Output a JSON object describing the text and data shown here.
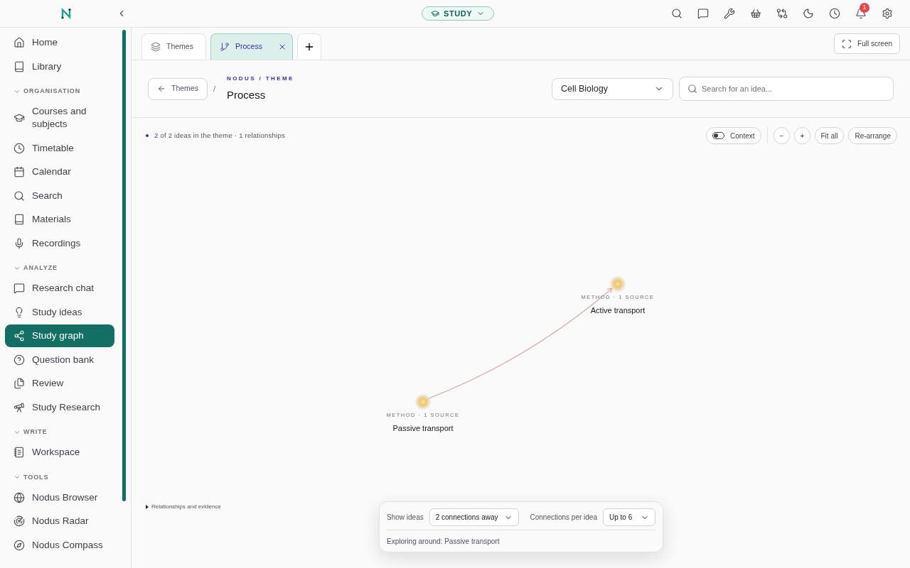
{
  "header": {
    "mode_button": "STUDY",
    "notification_count": "1"
  },
  "sidebar": {
    "top_items": [
      {
        "label": "Home",
        "selected": false
      },
      {
        "label": "Library",
        "selected": false
      }
    ],
    "sections": [
      {
        "title": "ORGANISATION",
        "expanded": true,
        "items": [
          {
            "label": "Courses and subjects",
            "selected": false
          },
          {
            "label": "Timetable",
            "selected": false
          },
          {
            "label": "Calendar",
            "selected": false
          },
          {
            "label": "Search",
            "selected": false
          },
          {
            "label": "Materials",
            "selected": false
          },
          {
            "label": "Recordings",
            "selected": false
          }
        ]
      },
      {
        "title": "ANALYZE",
        "expanded": true,
        "items": [
          {
            "label": "Research chat",
            "selected": false
          },
          {
            "label": "Study ideas",
            "selected": false
          },
          {
            "label": "Study graph",
            "selected": true
          },
          {
            "label": "Question bank",
            "selected": false
          },
          {
            "label": "Review",
            "selected": false
          },
          {
            "label": "Study Research",
            "selected": false
          }
        ]
      },
      {
        "title": "WRITE",
        "expanded": true,
        "items": [
          {
            "label": "Workspace",
            "selected": false
          }
        ]
      },
      {
        "title": "TOOLS",
        "expanded": true,
        "items": [
          {
            "label": "Nodus Browser",
            "selected": false
          },
          {
            "label": "Nodus Radar",
            "selected": false
          },
          {
            "label": "Nodus Compass",
            "selected": false
          }
        ]
      }
    ]
  },
  "tabs": [
    {
      "label": "Themes",
      "selected": false,
      "closable": false
    },
    {
      "label": "Process",
      "selected": true,
      "closable": true
    }
  ],
  "full_screen_button": "Full screen",
  "page": {
    "back_button": "Themes",
    "separator": "/",
    "eyebrow": "NODUS / THEME",
    "title": "Process",
    "subject_select": "Cell Biology",
    "search": {
      "placeholder": "Search for an idea..."
    }
  },
  "graph": {
    "summary": "2 of 2 ideas in the theme · 1 relationships",
    "context_toggle": {
      "label": "Context",
      "on": false
    },
    "zoom_out": "−",
    "zoom_in": "+",
    "fit_all": "Fit all",
    "rearrange": "Re-arrange",
    "nodes": [
      {
        "meta": "METHOD · 1 SOURCE",
        "label": "Active transport"
      },
      {
        "meta": "METHOD · 1 SOURCE",
        "label": "Passive transport"
      }
    ],
    "details_toggle": "Relationships and evidence"
  },
  "explore_panel": {
    "show_ideas_label": "Show ideas",
    "show_ideas_value": "2 connections away",
    "per_idea_label": "Connections per idea",
    "per_idea_value": "Up to 6",
    "status": "Exploring around: Passive transport"
  }
}
